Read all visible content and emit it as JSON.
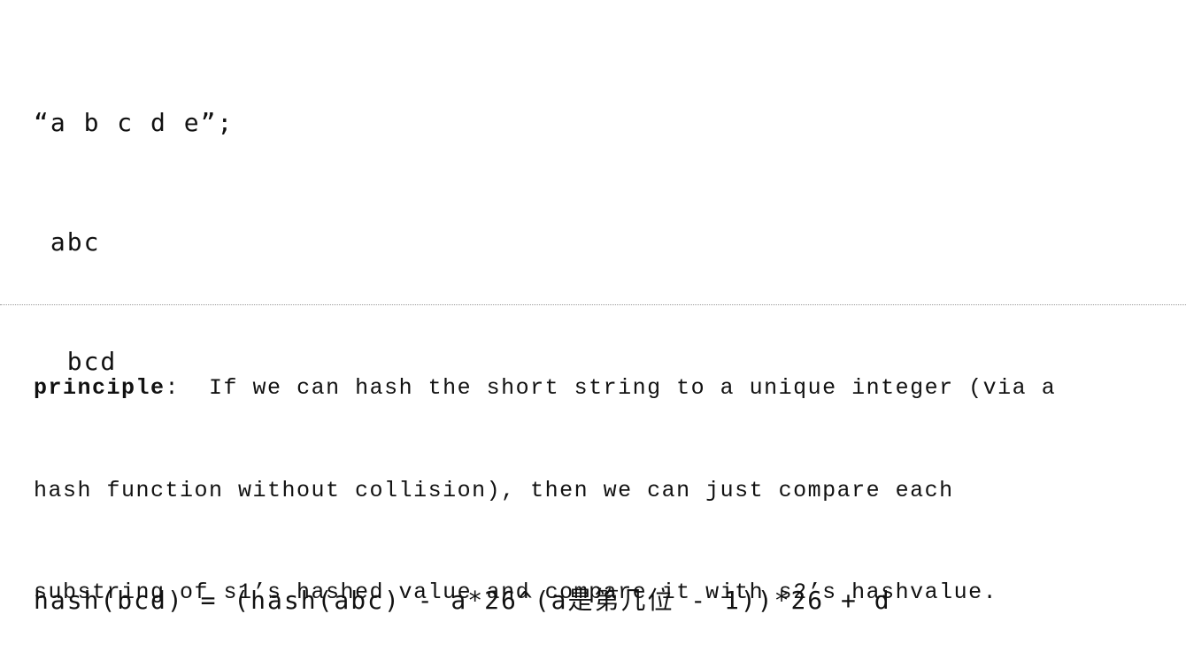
{
  "code": {
    "lines": [
      "“a b c d e”;",
      " abc",
      "  bcd",
      "",
      "hash(bcd) = (hash(abc) - a*26^(a是第几位 - 1))*26 + d"
    ]
  },
  "note": {
    "label": "principle",
    "colon": ":",
    "line1": "  If we can hash the short string to a unique integer (via a",
    "line2": "hash function without collision), then we can just compare each",
    "line3": "substring of s1’s hashed value and compare it with s2’s hashvalue."
  }
}
